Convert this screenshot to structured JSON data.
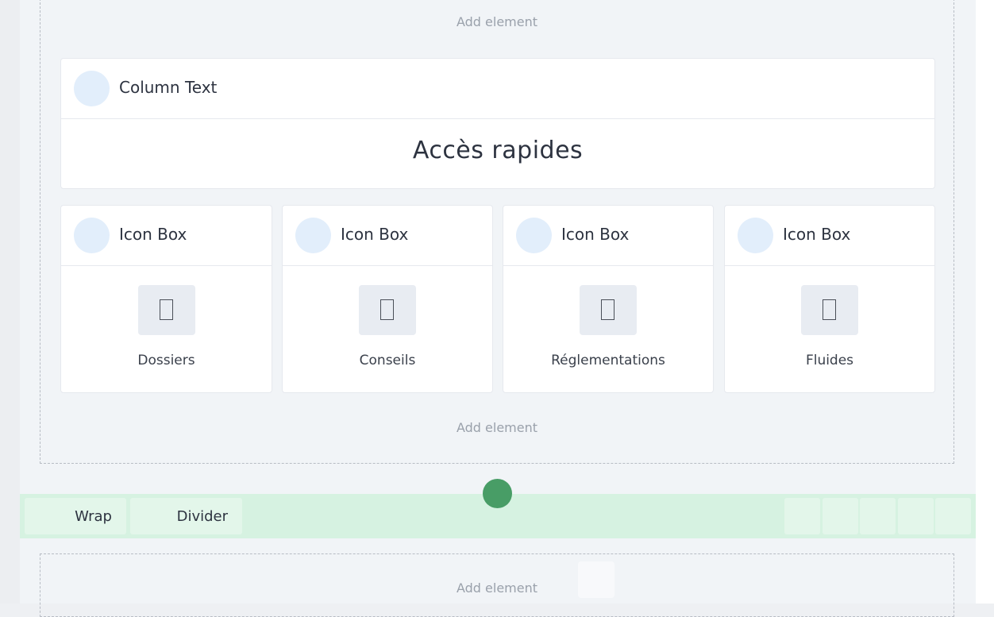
{
  "colors": {
    "canvas_bg": "#f1f4f7",
    "card_bg": "#ffffff",
    "avatar_bg": "#e2eefb",
    "toolbar_bg": "#d6f2e1",
    "handle": "#489d66",
    "muted_text": "#9aa1ab"
  },
  "top_section": {
    "add_element_label_top": "Add element",
    "add_element_label_bottom": "Add element",
    "column_text": {
      "title": "Column Text",
      "heading": "Accès rapides"
    },
    "icon_boxes": [
      {
        "title": "Icon Box",
        "icon": "placeholder-box-icon",
        "label": "Dossiers"
      },
      {
        "title": "Icon Box",
        "icon": "placeholder-box-icon",
        "label": "Conseils"
      },
      {
        "title": "Icon Box",
        "icon": "placeholder-box-icon",
        "label": "Réglementations"
      },
      {
        "title": "Icon Box",
        "icon": "placeholder-box-icon",
        "label": "Fluides"
      }
    ]
  },
  "toolbar": {
    "wrap_label": "Wrap",
    "divider_label": "Divider"
  },
  "bottom_section": {
    "add_element_label": "Add element"
  }
}
